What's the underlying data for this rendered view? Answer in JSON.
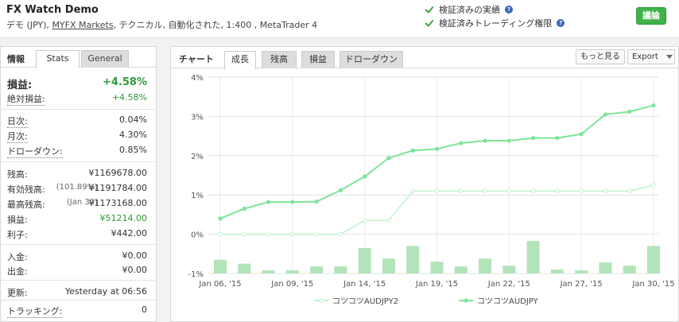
{
  "account": {
    "name": "FX Watch   Demo",
    "meta_prefix": "デモ (JPY),",
    "broker": "MYFX Markets",
    "meta_suffix": ", テクニカル, 自動化された, 1:400 , MetaTrader 4"
  },
  "verification": [
    {
      "label": "検証済みの実績",
      "icon": "check-icon"
    },
    {
      "label": "検証済みトレーディング権限",
      "icon": "check-icon"
    }
  ],
  "review_button": "議論",
  "left_panel": {
    "title": "情報",
    "tabs": [
      "Stats",
      "General"
    ],
    "active_tab": "Stats",
    "stats": {
      "gain": {
        "label": "損益:",
        "value": "+4.58%"
      },
      "abs_gain": {
        "label": "絶対損益:",
        "value": "+4.58%"
      },
      "daily": {
        "label": "日次:",
        "value": "0.04%"
      },
      "monthly": {
        "label": "月次:",
        "value": "4.30%"
      },
      "drawdown": {
        "label": "ドローダウン:",
        "value": "0.85%"
      },
      "balance": {
        "label": "残高:",
        "value": "¥1169678.00"
      },
      "equity": {
        "label": "有効残高:",
        "sub": "(101.89%)",
        "value": "¥1191784.00"
      },
      "highest": {
        "label": "最高残高:",
        "sub": "(Jan 30)",
        "value": "¥1173168.00"
      },
      "profit": {
        "label": "損益:",
        "value": "¥51214.00"
      },
      "interest": {
        "label": "利子:",
        "value": "¥442.00"
      },
      "deposits": {
        "label": "入金:",
        "value": "¥0.00"
      },
      "withdrawals": {
        "label": "出金:",
        "value": "¥0.00"
      },
      "updated": {
        "label": "更新:",
        "value": "Yesterday at 06:56"
      },
      "tracking": {
        "label": "トラッキング:",
        "value": "0"
      }
    }
  },
  "right_panel": {
    "title": "チャート",
    "tabs": [
      "成長",
      "残高",
      "損益",
      "ドローダウン"
    ],
    "active_tab": "成長",
    "more_button": "もっと見る",
    "export_button": "Export"
  },
  "colors": {
    "series_main": "#7de59a",
    "series_light": "#c2f1cf",
    "bar": "#b3e3b9",
    "accent_green": "#3fb24b"
  },
  "chart_data": {
    "type": "line",
    "y_axis": {
      "min": -1,
      "max": 4,
      "ticks": [
        "-1%",
        "0%",
        "1%",
        "2%",
        "3%",
        "4%"
      ]
    },
    "x_ticks": [
      "Jan 06, '15",
      "Jan 09, '15",
      "Jan 14, '15",
      "Jan 19, '15",
      "Jan 22, '15",
      "Jan 27, '15",
      "Jan 30, '15"
    ],
    "x_tick_index": [
      0,
      3,
      6,
      9,
      12,
      15,
      18
    ],
    "grid": true,
    "legend_position": "bottom",
    "series": [
      {
        "name": "コツコツAUDJPY2",
        "style": "light",
        "values": [
          0,
          0,
          0,
          0,
          0,
          0,
          0.35,
          0.35,
          1.1,
          1.1,
          1.1,
          1.1,
          1.1,
          1.1,
          1.1,
          1.1,
          1.1,
          1.1,
          1.25
        ]
      },
      {
        "name": "コツコツAUDJPY",
        "style": "main",
        "values": [
          0.4,
          0.65,
          0.82,
          0.82,
          0.83,
          1.12,
          1.47,
          1.94,
          2.13,
          2.17,
          2.32,
          2.38,
          2.38,
          2.45,
          2.45,
          2.55,
          3.05,
          3.12,
          3.28
        ]
      }
    ],
    "bars": [
      0.35,
      0.25,
      0.08,
      0.08,
      0.18,
      0.18,
      0.65,
      0.38,
      0.7,
      0.3,
      0.18,
      0.38,
      0.2,
      0.83,
      0.1,
      0.08,
      0.28,
      0.2,
      0.7
    ]
  }
}
